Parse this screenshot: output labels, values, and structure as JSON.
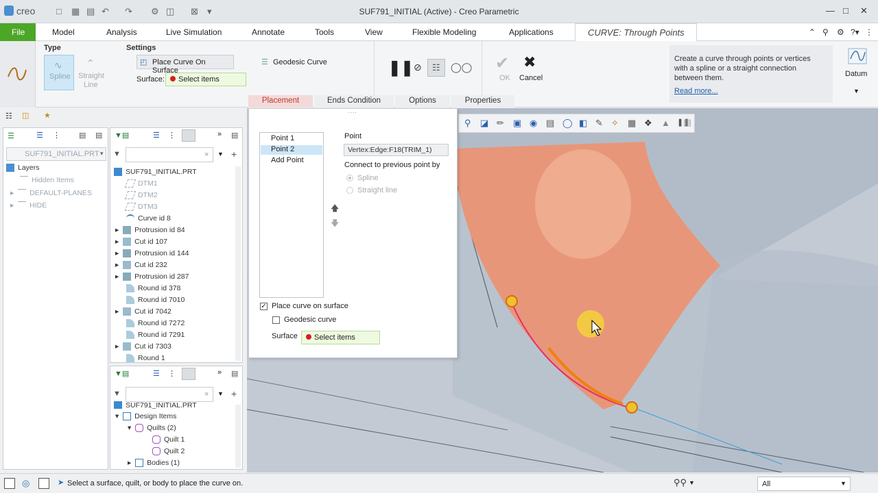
{
  "window": {
    "logo": "creo",
    "title": "SUF791_INITIAL (Active) - Creo Parametric"
  },
  "menu": {
    "file": "File",
    "items": [
      "Model",
      "Analysis",
      "Live Simulation",
      "Annotate",
      "Tools",
      "View",
      "Flexible Modeling",
      "Applications"
    ],
    "active_tab": "CURVE: Through Points"
  },
  "ribbon": {
    "type_label": "Type",
    "spline": "Spline",
    "straight_line_1": "Straight",
    "straight_line_2": "Line",
    "settings_label": "Settings",
    "place_on_surface": "Place Curve On Surface",
    "geodesic": "Geodesic Curve",
    "surface_label": "Surface:",
    "select_items": "Select items",
    "ok": "OK",
    "cancel": "Cancel",
    "help_text": "Create a curve through points or vertices with a spline or a straight connection between them.",
    "read_more": "Read more...",
    "datum": "Datum"
  },
  "dash_tabs": [
    "Placement",
    "Ends Condition",
    "Options",
    "Properties"
  ],
  "layers": {
    "part": "SUF791_INITIAL.PRT",
    "root": "Layers",
    "items": [
      "Hidden Items",
      "DEFAULT-PLANES",
      "HIDE"
    ]
  },
  "model_tree": {
    "root": "SUF791_INITIAL.PRT",
    "items": [
      "DTM1",
      "DTM2",
      "DTM3",
      "Curve id 8",
      "Protrusion id 84",
      "Cut id 107",
      "Protrusion id 144",
      "Cut id 232",
      "Protrusion id 287",
      "Round id 378",
      "Round id 7010",
      "Cut id 7042",
      "Round id 7272",
      "Round id 7291",
      "Cut id 7303",
      "Round 1"
    ]
  },
  "detail_tree": {
    "root": "SUF791_INITIAL.PRT",
    "design_items": "Design Items",
    "quilts": "Quilts (2)",
    "quilt1": "Quilt 1",
    "quilt2": "Quilt 2",
    "bodies": "Bodies (1)"
  },
  "placement": {
    "points": [
      "Point 1",
      "Point 2",
      "Add Point"
    ],
    "point_label": "Point",
    "point_value": "Vertex:Edge:F18(TRIM_1)",
    "connect_label": "Connect to previous point by",
    "spline": "Spline",
    "straight": "Straight line",
    "place_on_surface": "Place curve on surface",
    "geodesic": "Geodesic curve",
    "surface_label": "Surface",
    "select_items": "Select items"
  },
  "status": {
    "message": "Select a surface, quilt, or body to place the curve on.",
    "filter": "All"
  },
  "colors": {
    "file_green": "#4ca627",
    "surface_orange": "#e8967a",
    "surface_blue": "#b8c2cf",
    "select_green": "#eefadf"
  }
}
